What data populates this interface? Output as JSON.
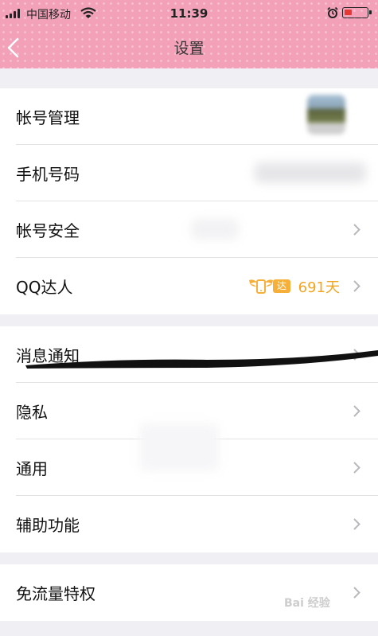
{
  "status_bar": {
    "carrier": "中国移动",
    "time": "11:39"
  },
  "nav": {
    "title": "设置"
  },
  "groups": [
    {
      "items": [
        {
          "label": "帐号管理"
        },
        {
          "label": "手机号码"
        },
        {
          "label": "帐号安全"
        },
        {
          "label": "QQ达人",
          "badge": "达人",
          "value": "691天"
        }
      ]
    },
    {
      "items": [
        {
          "label": "消息通知"
        },
        {
          "label": "隐私"
        },
        {
          "label": "通用"
        },
        {
          "label": "辅助功能"
        }
      ]
    },
    {
      "items": [
        {
          "label": "免流量特权"
        }
      ]
    }
  ],
  "watermark": "Bai 经验",
  "colors": {
    "header_bg": "#f2a1b9",
    "accent": "#f3a521",
    "page_bg": "#efeff4"
  }
}
